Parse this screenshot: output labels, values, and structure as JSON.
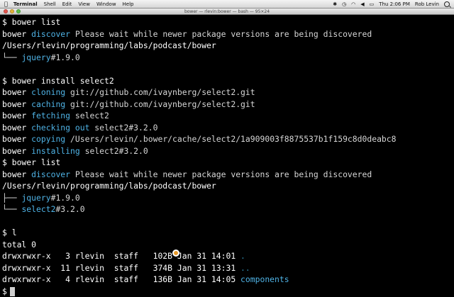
{
  "menubar": {
    "apple_icon": "apple-logo",
    "app_name": "Terminal",
    "items": [
      "Shell",
      "Edit",
      "View",
      "Window",
      "Help"
    ],
    "clock": "Thu 2:06 PM",
    "user": "Rob Levin"
  },
  "window": {
    "title": "bower — rlevin:bower — bash — 95×24"
  },
  "terminal": {
    "lines": [
      [
        {
          "t": "$ bower list",
          "c": "white"
        }
      ],
      [
        {
          "t": "bower ",
          "c": "white"
        },
        {
          "t": "discover",
          "c": "cyan"
        },
        {
          "t": " Please wait while newer package versions are being discovered",
          "c": "plain"
        }
      ],
      [
        {
          "t": "/Users/rlevin/programming/labs/podcast/bower",
          "c": "white"
        }
      ],
      [
        {
          "t": "└── ",
          "c": "plain"
        },
        {
          "t": "jquery",
          "c": "cyan"
        },
        {
          "t": "#1.9.0",
          "c": "plain"
        }
      ],
      [
        {
          "t": "",
          "c": "plain"
        }
      ],
      [
        {
          "t": "$ bower install select2",
          "c": "white"
        }
      ],
      [
        {
          "t": "bower ",
          "c": "white"
        },
        {
          "t": "cloning",
          "c": "cyan"
        },
        {
          "t": " git://github.com/ivaynberg/select2.git",
          "c": "plain"
        }
      ],
      [
        {
          "t": "bower ",
          "c": "white"
        },
        {
          "t": "caching",
          "c": "cyan"
        },
        {
          "t": " git://github.com/ivaynberg/select2.git",
          "c": "plain"
        }
      ],
      [
        {
          "t": "bower ",
          "c": "white"
        },
        {
          "t": "fetching",
          "c": "cyan"
        },
        {
          "t": " select2",
          "c": "plain"
        }
      ],
      [
        {
          "t": "bower ",
          "c": "white"
        },
        {
          "t": "checking out",
          "c": "cyan"
        },
        {
          "t": " select2#3.2.0",
          "c": "plain"
        }
      ],
      [
        {
          "t": "bower ",
          "c": "white"
        },
        {
          "t": "copying",
          "c": "cyan"
        },
        {
          "t": " /Users/rlevin/.bower/cache/select2/1a909003f8875537b1f159c8d0deabc8",
          "c": "plain"
        }
      ],
      [
        {
          "t": "bower ",
          "c": "white"
        },
        {
          "t": "installing",
          "c": "cyan"
        },
        {
          "t": " select2#3.2.0",
          "c": "plain"
        }
      ],
      [
        {
          "t": "$ bower list",
          "c": "white"
        }
      ],
      [
        {
          "t": "bower ",
          "c": "white"
        },
        {
          "t": "discover",
          "c": "cyan"
        },
        {
          "t": " Please wait while newer package versions are being discovered",
          "c": "plain"
        }
      ],
      [
        {
          "t": "/Users/rlevin/programming/labs/podcast/bower",
          "c": "white"
        }
      ],
      [
        {
          "t": "├── ",
          "c": "plain"
        },
        {
          "t": "jquery",
          "c": "cyan"
        },
        {
          "t": "#1.9.0",
          "c": "plain"
        }
      ],
      [
        {
          "t": "└── ",
          "c": "plain"
        },
        {
          "t": "select2",
          "c": "cyan"
        },
        {
          "t": "#3.2.0",
          "c": "plain"
        }
      ],
      [
        {
          "t": "",
          "c": "plain"
        }
      ],
      [
        {
          "t": "$ l",
          "c": "white"
        }
      ],
      [
        {
          "t": "total 0",
          "c": "white"
        }
      ],
      [
        {
          "t": "drwxrwxr-x   3 rlevin  staff   102B Jan 31 14:01 ",
          "c": "white"
        },
        {
          "t": ".",
          "c": "green"
        }
      ],
      [
        {
          "t": "drwxrwxr-x  11 rlevin  staff   374B Jan 31 13:31 ",
          "c": "white"
        },
        {
          "t": "..",
          "c": "green"
        }
      ],
      [
        {
          "t": "drwxrwxr-x   4 rlevin  staff   136B Jan 31 14:05 ",
          "c": "white"
        },
        {
          "t": "components",
          "c": "cyan"
        }
      ],
      [
        {
          "t": "$",
          "c": "white"
        }
      ]
    ]
  }
}
